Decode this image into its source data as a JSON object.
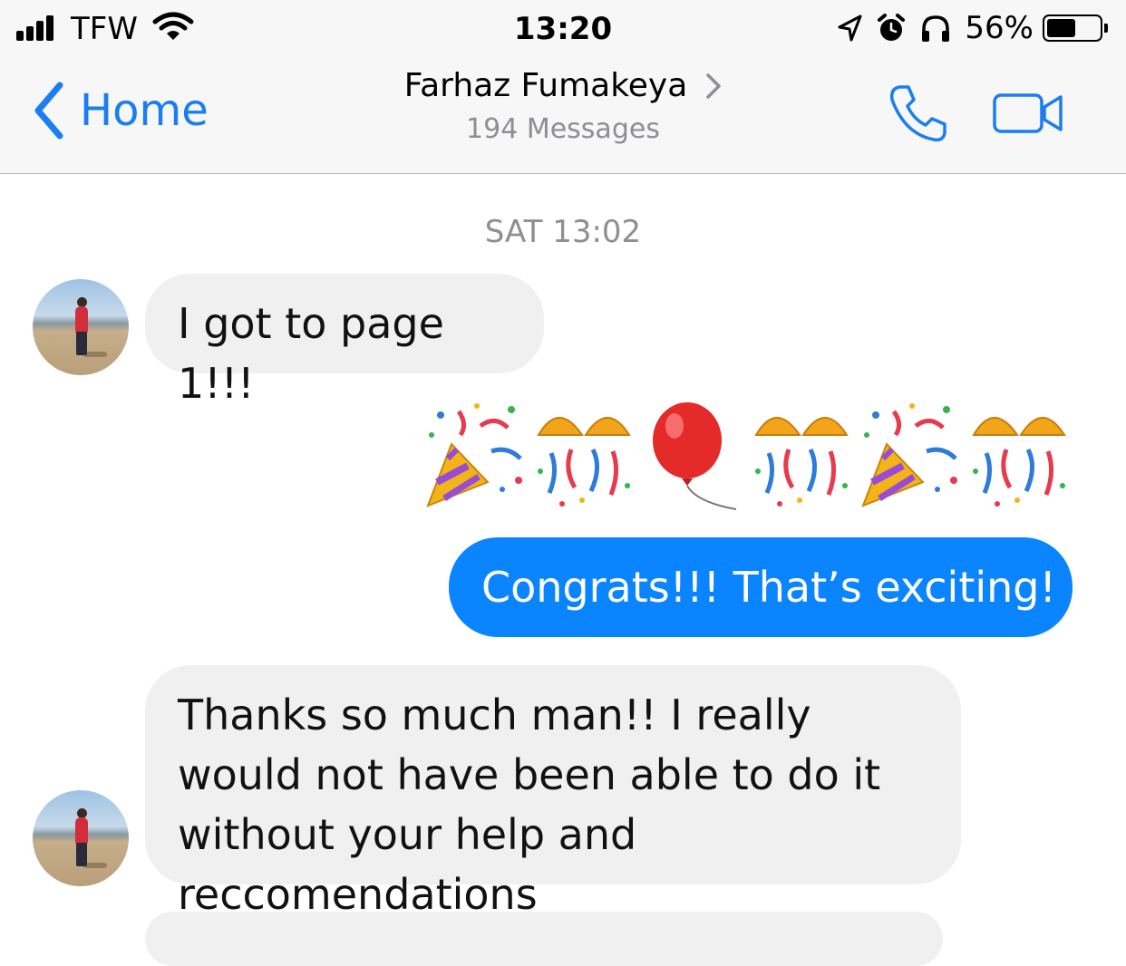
{
  "status_bar": {
    "carrier": "TFW",
    "time": "13:20",
    "battery_percent_label": "56%",
    "battery_level": 0.56
  },
  "navbar": {
    "back_label": "Home",
    "contact_name": "Farhaz Fumakeya",
    "message_count": "194 Messages",
    "accent_color": "#1a7ef2"
  },
  "thread": {
    "timestamp": "SAT 13:02",
    "messages": [
      {
        "direction": "incoming",
        "text": "I got to page 1!!!"
      },
      {
        "direction": "outgoing",
        "emoji": [
          "party-popper",
          "confetti-ball",
          "balloon",
          "confetti-ball",
          "party-popper",
          "confetti-ball"
        ]
      },
      {
        "direction": "outgoing",
        "text": "Congrats!!! That’s exciting!"
      },
      {
        "direction": "incoming",
        "text": "Thanks so much man!! I really would not have been able to do it without your help and reccomendations"
      }
    ],
    "outgoing_bubble_color": "#0a84ff",
    "incoming_bubble_color": "#f1f0f0"
  }
}
